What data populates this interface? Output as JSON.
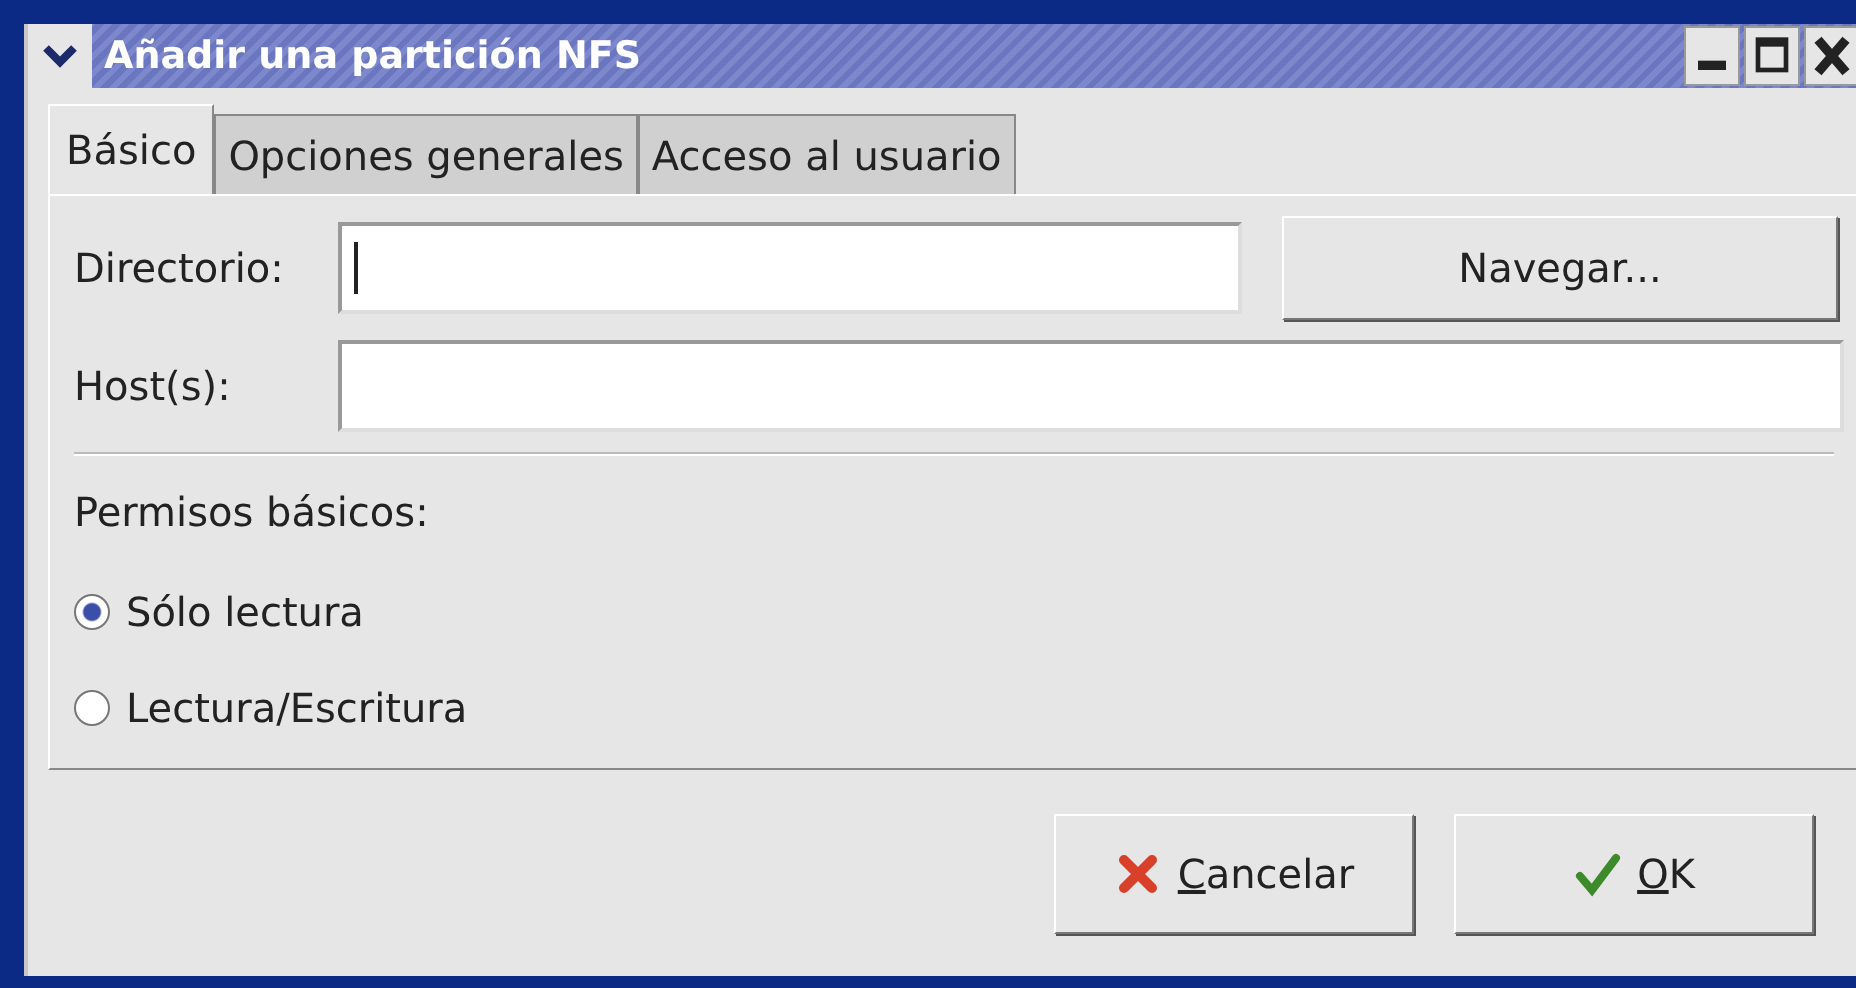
{
  "window": {
    "title": "Añadir una partición NFS"
  },
  "tabs": [
    {
      "label": "Básico",
      "selected": true
    },
    {
      "label": "Opciones generales",
      "selected": false
    },
    {
      "label": "Acceso al usuario",
      "selected": false
    }
  ],
  "directory": {
    "label": "Directorio:"
  },
  "browse_button": "Navegar...",
  "hosts": {
    "label": "Host(s):"
  },
  "permissions": {
    "heading": "Permisos básicos:",
    "options": [
      {
        "label": "Sólo lectura",
        "selected": true
      },
      {
        "label": "Lectura/Escritura",
        "selected": false
      }
    ]
  },
  "buttons": [
    {
      "kind": "cancel",
      "label": "Cancelar",
      "mnemonic": true
    },
    {
      "kind": "ok",
      "label": "OK",
      "mnemonic": true
    }
  ]
}
